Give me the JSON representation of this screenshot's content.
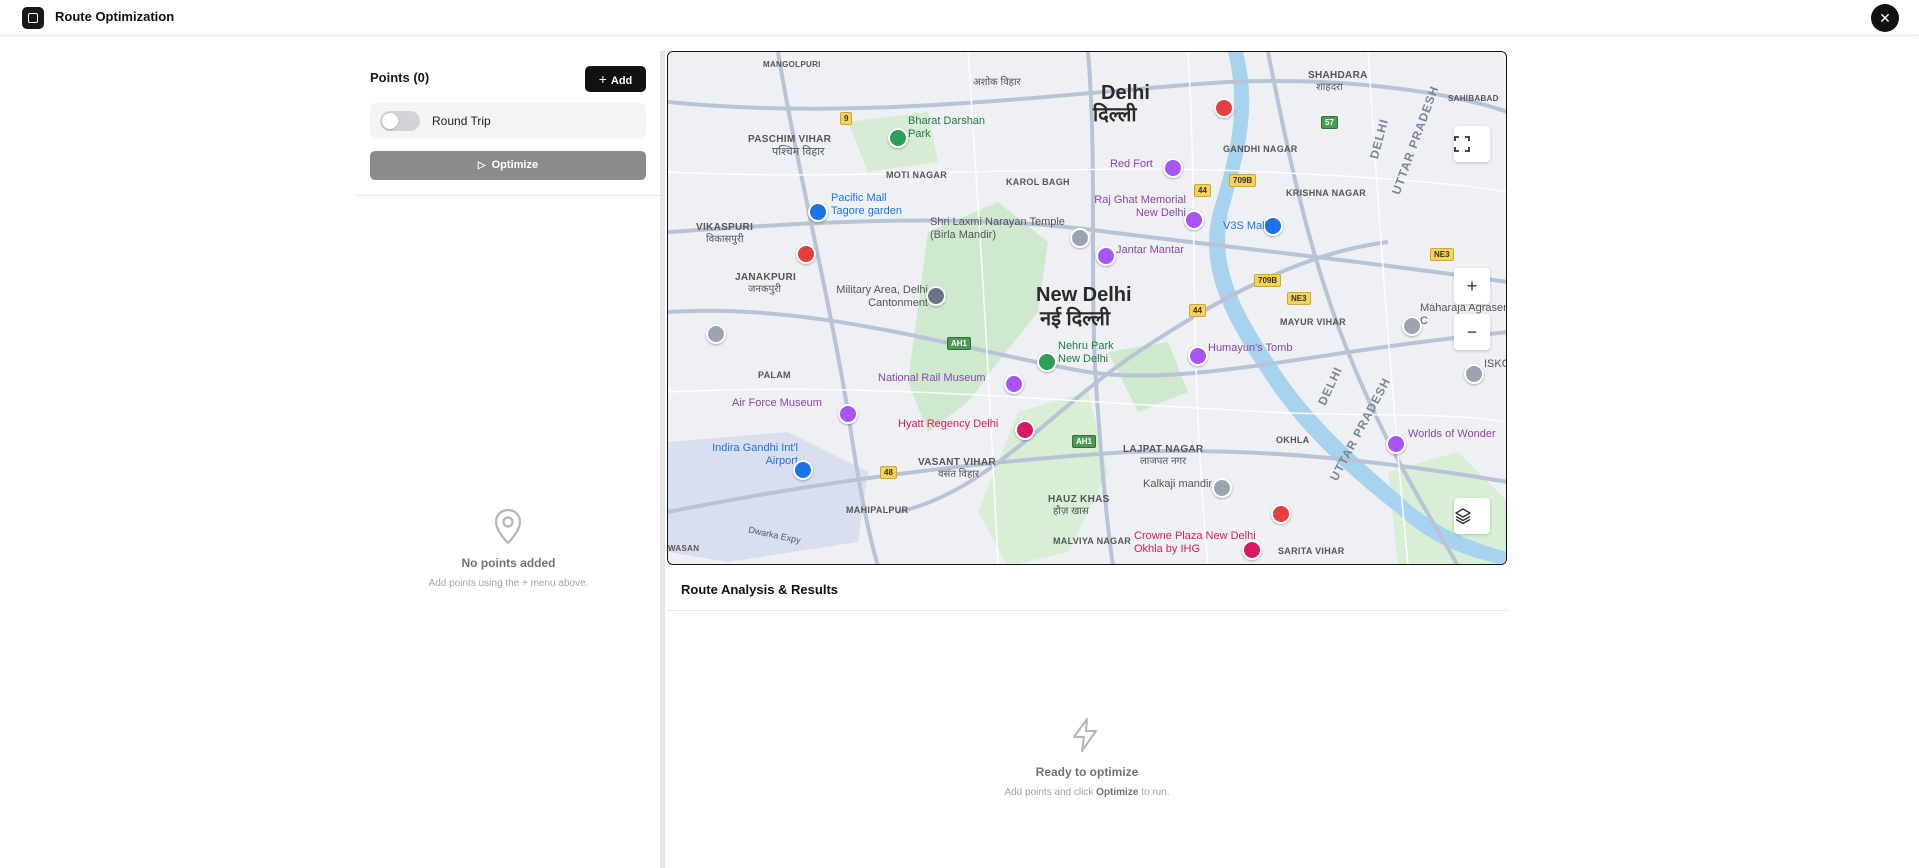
{
  "app": {
    "title": "Route Optimization",
    "icon": "app-square-icon",
    "close_icon": "close-icon",
    "close_glyph": "✕"
  },
  "points_panel": {
    "title": "Points (0)",
    "add_label": "Add",
    "add_icon": "plus-icon",
    "round_trip_label": "Round Trip",
    "round_trip_on": false,
    "optimize_label": "Optimize",
    "optimize_icon": "play-icon",
    "empty_icon": "map-pin-icon",
    "empty_title": "No points added",
    "empty_subtitle": "Add points using the + menu above."
  },
  "map": {
    "controls": {
      "fullscreen_icon": "fullscreen-icon",
      "zoom_in_icon": "zoom-in-icon",
      "zoom_out_icon": "zoom-out-icon",
      "layers_icon": "layers-icon"
    },
    "labels": {
      "delhi_en": "Delhi",
      "delhi_hi": "दिल्ली",
      "newdelhi_en": "New Delhi",
      "newdelhi_hi": "नई दिल्ली",
      "paschim_vihar": "PASCHIM VIHAR",
      "paschim_vihar_hi": "पश्चिम विहार",
      "mangolpuri": "MANGOLPURI",
      "ashok_vihar": "अशोक विहार",
      "shahdara": "SHAHDARA",
      "shahdara_hi": "शाहदरा",
      "gandhi_nagar": "GANDHI NAGAR",
      "krishna_nagar": "KRISHNA NAGAR",
      "moti_nagar": "MOTI NAGAR",
      "karol_bagh": "KAROL BAGH",
      "vikaspuri": "VIKASPURI",
      "vikaspuri_hi": "विकासपुरी",
      "janakpuri": "JANAKPURI",
      "janakpuri_hi": "जनकपुरी",
      "palam": "PALAM",
      "vasant_vihar": "VASANT VIHAR",
      "vasant_vihar_hi": "वसंत विहार",
      "lajpat_nagar": "LAJPAT NAGAR",
      "lajpat_nagar_hi": "लाजपत नगर",
      "hauz_khas": "HAUZ KHAS",
      "hauz_khas_hi": "हौज़ खास",
      "mahipalpur": "MAHIPALPUR",
      "malviya_nagar": "MALVIYA NAGAR",
      "okhla": "OKHLA",
      "mayur_vihar": "MAYUR VIHAR",
      "sarita_vihar": "SARITA VIHAR",
      "sahibabad": "SAHIBABAD",
      "uttar_pradesh": "UTTAR PRADESH",
      "delhi_state": "DELHI",
      "bharat_darshan": "Bharat Darshan Park",
      "red_fort": "Red Fort",
      "raj_ghat": "Raj Ghat Memorial New Delhi",
      "v3s": "V3S Mall",
      "pacific_mall": "Pacific Mall Tagore garden",
      "birla": "Shri Laxmi Narayan Temple (Birla Mandir)",
      "jantar": "Jantar Mantar",
      "military": "Military Area, Delhi Cantonment",
      "maharaja": "Maharaja Agrasen C",
      "nehru_park": "Nehru Park New Delhi",
      "humayun": "Humayun's Tomb",
      "rail_museum": "National Rail Museum",
      "air_force": "Air Force Museum",
      "hyatt": "Hyatt Regency Delhi",
      "airport": "Indira Gandhi Int'l Airport",
      "kalkaji": "Kalkaji mandir",
      "crowne": "Crowne Plaza New Delhi Okhla by IHG",
      "worlds": "Worlds of Wonder",
      "iskcon": "ISKCO",
      "dwarka": "Dwarka Expy",
      "wasan": "WASAN"
    },
    "shields": {
      "r9": "9",
      "r709b": "709B",
      "r44": "44",
      "r57": "57",
      "ne3": "NE3",
      "ah1": "AH1",
      "r48": "48"
    }
  },
  "results": {
    "title": "Route Analysis & Results",
    "empty_icon": "bolt-icon",
    "empty_title": "Ready to optimize",
    "empty_prefix": "Add points and click",
    "empty_action": "Optimize",
    "empty_suffix": "to run."
  },
  "colors": {
    "primary": "#111111",
    "disabled": "#8b8b8b",
    "muted": "#71717a"
  }
}
